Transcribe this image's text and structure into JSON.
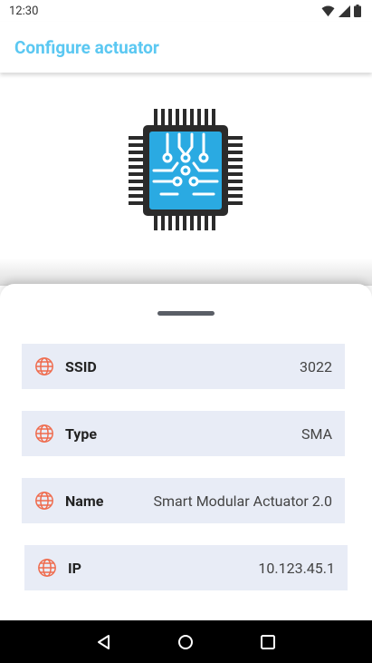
{
  "status_bar": {
    "time": "12:30"
  },
  "app_bar": {
    "title": "Configure actuator"
  },
  "details": [
    {
      "label": "SSID",
      "value": "3022"
    },
    {
      "label": "Type",
      "value": "SMA"
    },
    {
      "label": "Name",
      "value": "Smart Modular Actuator 2.0"
    },
    {
      "label": "IP",
      "value": "10.123.45.1"
    }
  ],
  "icons": {
    "row_icon": "globe-icon",
    "device": "microchip-icon",
    "nav": [
      "back-icon",
      "home-icon",
      "recents-icon"
    ]
  },
  "colors": {
    "accent": "#5bc8f2",
    "row_background": "#e8ecf6",
    "globe": "#ef6b4d",
    "chip": "#2aaae2"
  }
}
